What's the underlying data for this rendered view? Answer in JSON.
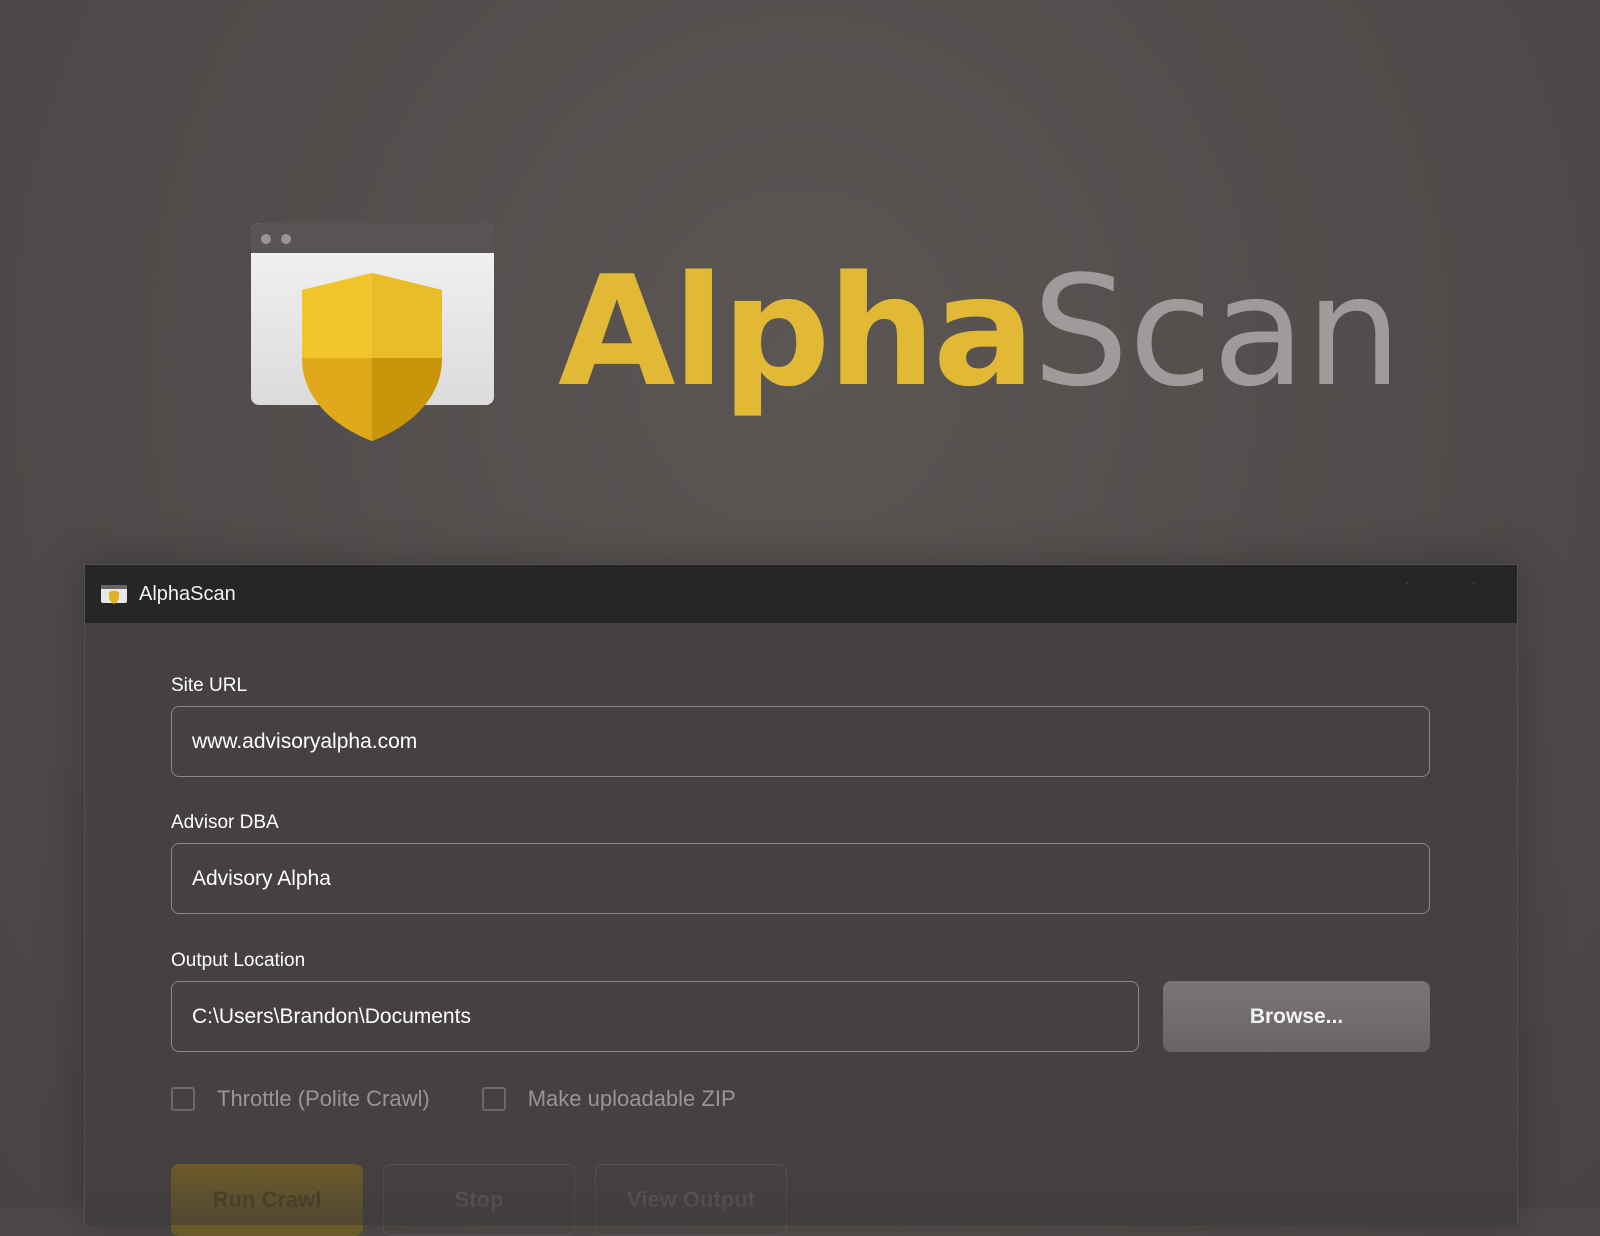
{
  "hero": {
    "logo_icon": "shield-window-icon",
    "wordmark_bold": "Alpha",
    "wordmark_light": "Scan",
    "colors": {
      "gold": "#e2b935",
      "gray": "#a09b9b"
    }
  },
  "window": {
    "title": "AlphaScan",
    "icon": "app-shield-icon"
  },
  "form": {
    "site_url": {
      "label": "Site URL",
      "value": "www.advisoryalpha.com"
    },
    "advisor_dba": {
      "label": "Advisor DBA",
      "value": "Advisory Alpha"
    },
    "output_location": {
      "label": "Output Location",
      "value": "C:\\Users\\Brandon\\Documents",
      "browse_label": "Browse..."
    },
    "options": [
      {
        "label": "Throttle (Polite Crawl)",
        "checked": false
      },
      {
        "label": "Make uploadable ZIP",
        "checked": false
      }
    ],
    "actions": {
      "run": "Run Crawl",
      "stop": "Stop",
      "view": "View Output"
    }
  }
}
